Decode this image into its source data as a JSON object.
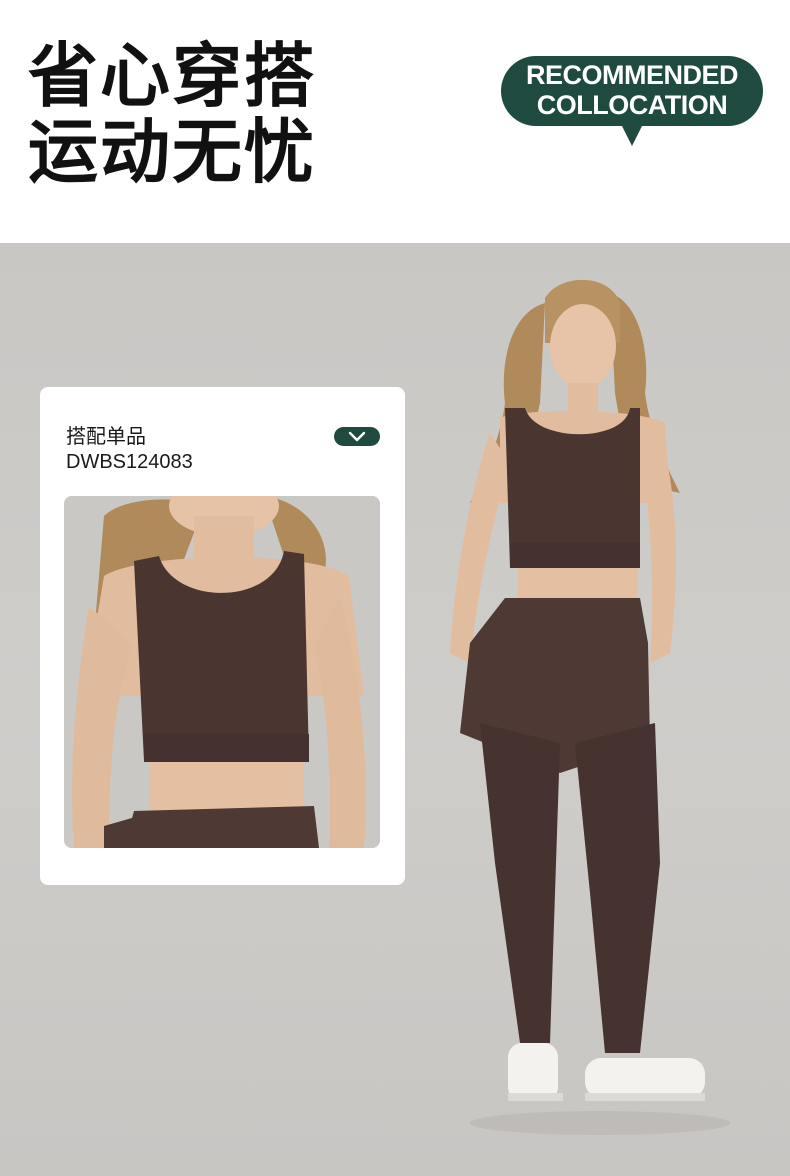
{
  "header": {
    "headline_line1": "省心穿搭",
    "headline_line2": "运动无忧",
    "badge_line1": "RECOMMENDED",
    "badge_line2": "COLLOCATION",
    "badge_color": "#1f4a3f"
  },
  "card": {
    "title": "搭配单品",
    "sku": "DWBS124083",
    "expand_icon": "chevron-down-icon",
    "accent_color": "#1f4a3f"
  },
  "colors": {
    "garment": "#4a3531",
    "background": "#cbc9c6",
    "headline": "#111111"
  }
}
